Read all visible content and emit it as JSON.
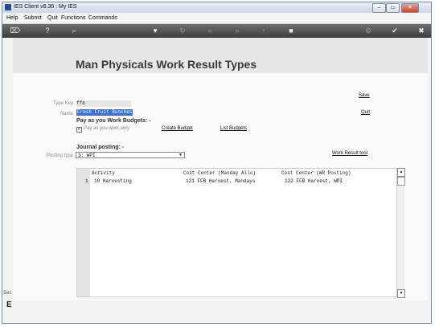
{
  "window": {
    "title": "IES Client v8.36 : My IES"
  },
  "window_controls": {
    "minimize": "–",
    "maximize": "▭",
    "close": "✕"
  },
  "menu": {
    "items": [
      "Help",
      "Submit",
      "Quit",
      "Functions",
      "Commands"
    ]
  },
  "toolbar": {
    "icons": [
      {
        "name": "key-icon",
        "glyph": "⌦",
        "enabled": true
      },
      {
        "name": "help-icon",
        "glyph": "?",
        "enabled": true
      },
      {
        "name": "search-icon",
        "glyph": "⌕",
        "enabled": true
      },
      {
        "name": "favorite-icon",
        "glyph": "♥",
        "enabled": true
      },
      {
        "name": "refresh-icon",
        "glyph": "↻",
        "enabled": false
      },
      {
        "name": "rewind-icon",
        "glyph": "«",
        "enabled": false
      },
      {
        "name": "forward-icon",
        "glyph": "»",
        "enabled": false
      },
      {
        "name": "upload-icon",
        "glyph": "↑",
        "enabled": false
      },
      {
        "name": "stop-icon",
        "glyph": "■",
        "enabled": true
      },
      {
        "name": "settings-icon",
        "glyph": "⚙",
        "enabled": false
      },
      {
        "name": "confirm-icon",
        "glyph": "✔",
        "enabled": true
      },
      {
        "name": "close-icon",
        "glyph": "✖",
        "enabled": true
      }
    ]
  },
  "page": {
    "title": "Man Physicals Work Result Types"
  },
  "form": {
    "type_key_label": "Type Key",
    "type_key_value": "ffb",
    "name_label": "Name",
    "name_value": "Fresh Fruit Bunches",
    "budgets_heading": "Pay as you Work Budgets: -",
    "pay_as_you_work_only_label": "Pay as you work only",
    "pay_as_you_work_only_checked": true,
    "create_budget_link": "Create Budget",
    "list_budgets_link": "List Budgets",
    "journal_heading": "Journal posting: -",
    "posting_type_label": "Posting type",
    "posting_type_value": "3: WPI",
    "work_result_tool_link": "Work Result tool",
    "save_link": "Save",
    "quit_link": "Quit"
  },
  "grid": {
    "columns": [
      "Activity",
      "Cost Center (Manday Allo)",
      "Cost Center (WR Posting)"
    ],
    "rows": [
      {
        "num": "1",
        "activity": "10 Harvesting",
        "cc_manday": "121 FFB Harvest, Mandays",
        "cc_wr": "122 FFB Harvest, WPI"
      }
    ]
  },
  "left_strip": {
    "top": "Ses",
    "bottom": "E"
  },
  "colors": {
    "selection": "#3b6fd6",
    "toolbar": "#4a4a4a"
  }
}
